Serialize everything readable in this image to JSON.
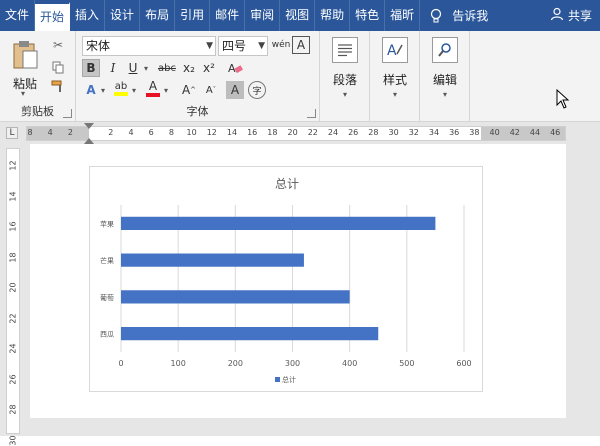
{
  "tabs": [
    {
      "label": "文件",
      "active": false
    },
    {
      "label": "开始",
      "active": true
    },
    {
      "label": "插入",
      "active": false
    },
    {
      "label": "设计",
      "active": false
    },
    {
      "label": "布局",
      "active": false
    },
    {
      "label": "引用",
      "active": false
    },
    {
      "label": "邮件",
      "active": false
    },
    {
      "label": "审阅",
      "active": false
    },
    {
      "label": "视图",
      "active": false
    },
    {
      "label": "帮助",
      "active": false
    },
    {
      "label": "特色",
      "active": false
    },
    {
      "label": "福昕",
      "active": false
    }
  ],
  "tell_me": "告诉我",
  "share": "共享",
  "clipboard": {
    "paste_label": "粘贴",
    "group_label": "剪贴板"
  },
  "font": {
    "name": "宋体",
    "size": "四号",
    "wen_glyph": "wén",
    "a_box_glyph": "A",
    "bold": "B",
    "italic": "I",
    "underline": "U",
    "strike": "abc",
    "subscript": "x₂",
    "superscript": "x²",
    "effects_glyph": "A",
    "highlight_glyph": "ab",
    "font_color_glyph": "A",
    "grow_glyph": "A",
    "shrink_glyph": "A",
    "char_shading_glyph": "A",
    "enclose_glyph": "字",
    "group_label": "字体",
    "highlight_color": "#ffff00",
    "font_color": "#e81123"
  },
  "paragraph": {
    "label": "段落"
  },
  "styles": {
    "label": "样式"
  },
  "editing": {
    "label": "编辑"
  },
  "ruler": {
    "corner": "L",
    "ticks": [
      "8",
      "4",
      "2",
      "",
      "2",
      "4",
      "6",
      "8",
      "10",
      "12",
      "14",
      "16",
      "18",
      "20",
      "22",
      "24",
      "26",
      "28",
      "30",
      "32",
      "34",
      "36",
      "38",
      "40",
      "42",
      "44",
      "46"
    ],
    "vticks": [
      "12",
      "14",
      "16",
      "18",
      "20",
      "22",
      "24",
      "26",
      "28",
      "30"
    ]
  },
  "chart_data": {
    "type": "bar",
    "orientation": "horizontal",
    "title": "总计",
    "categories": [
      "苹果",
      "芒果",
      "葡萄",
      "西瓜"
    ],
    "series": [
      {
        "name": "总计",
        "values": [
          550,
          320,
          400,
          450
        ],
        "color": "#4472c4"
      }
    ],
    "xlim": [
      0,
      600
    ],
    "xticks": [
      0,
      100,
      200,
      300,
      400,
      500,
      600
    ],
    "grid": true,
    "legend": "bottom"
  }
}
